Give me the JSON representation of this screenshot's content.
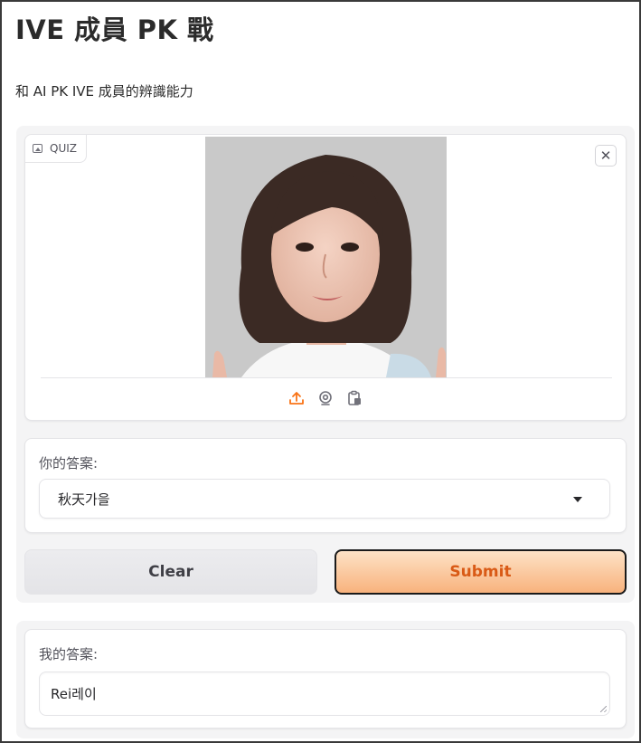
{
  "header": {
    "title": "IVE 成員 PK 戰",
    "subtitle": "和 AI PK IVE 成員的辨識能力"
  },
  "quiz_image": {
    "label": "QUIZ",
    "label_icon": "image-icon",
    "close_icon": "close-icon",
    "source_icons": [
      "upload-icon",
      "webcam-icon",
      "clipboard-icon"
    ]
  },
  "your_answer": {
    "label": "你的答案:",
    "selected": "秋天가을"
  },
  "buttons": {
    "clear": "Clear",
    "submit": "Submit"
  },
  "my_answer": {
    "label": "我的答案:",
    "value": "Rei레이"
  },
  "colors": {
    "accent": "#f97316",
    "submit_text": "#d95a16",
    "submit_bg_top": "#fde2c6",
    "submit_bg_bottom": "#f8b27d",
    "panel_bg": "#f4f4f5"
  }
}
